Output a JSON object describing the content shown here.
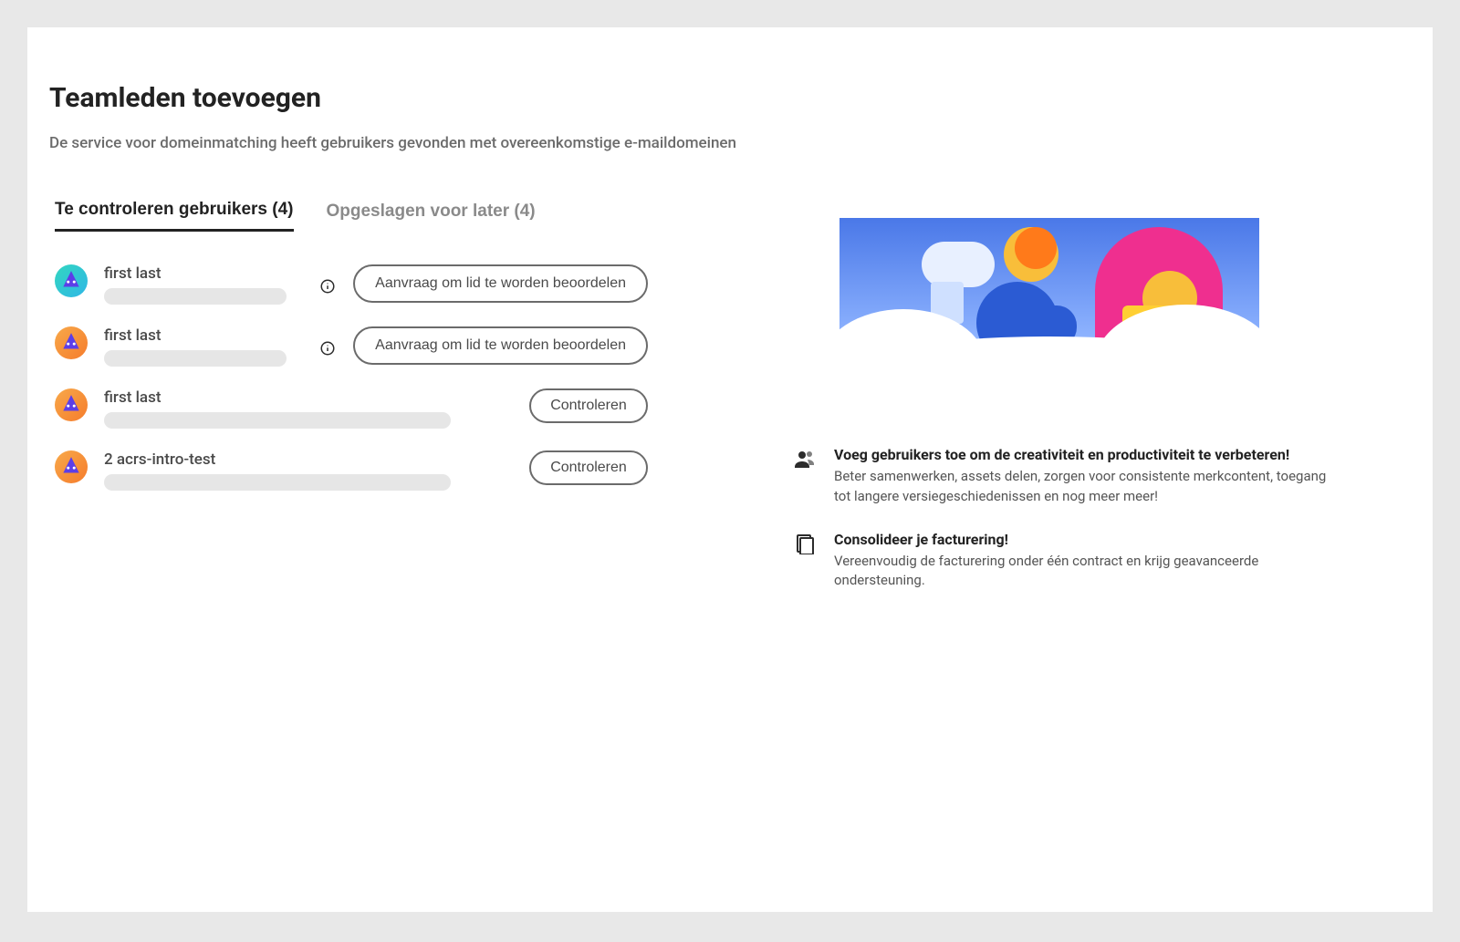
{
  "header": {
    "title": "Teamleden toevoegen",
    "subtitle": "De service voor domeinmatching heeft gebruikers gevonden met overeenkomstige e-maildomeinen"
  },
  "tabs": {
    "review": "Te controleren gebruikers (4)",
    "saved": "Opgeslagen voor later (4)"
  },
  "users": [
    {
      "name": "first last",
      "avatar": "teal",
      "hasInfo": true,
      "redact": "short",
      "action": "review_request"
    },
    {
      "name": "first last",
      "avatar": "orange",
      "hasInfo": true,
      "redact": "short",
      "action": "review_request"
    },
    {
      "name": "first last",
      "avatar": "orange",
      "hasInfo": false,
      "redact": "long",
      "action": "review"
    },
    {
      "name": "2 acrs-intro-test",
      "avatar": "orange",
      "hasInfo": false,
      "redact": "long",
      "action": "review"
    }
  ],
  "buttons": {
    "review_request": "Aanvraag om lid te worden beoordelen",
    "review": "Controleren"
  },
  "promos": [
    {
      "icon": "people",
      "title": "Voeg gebruikers toe om de creativiteit en productiviteit te verbeteren!",
      "body": "Beter samenwerken, assets delen, zorgen voor consistente merkcontent, toegang tot langere versiegeschiedenissen en nog meer meer!"
    },
    {
      "icon": "billing",
      "title": "Consolideer je facturering!",
      "body": "Vereenvoudig de facturering onder één contract en krijg geavanceerde ondersteuning."
    }
  ]
}
